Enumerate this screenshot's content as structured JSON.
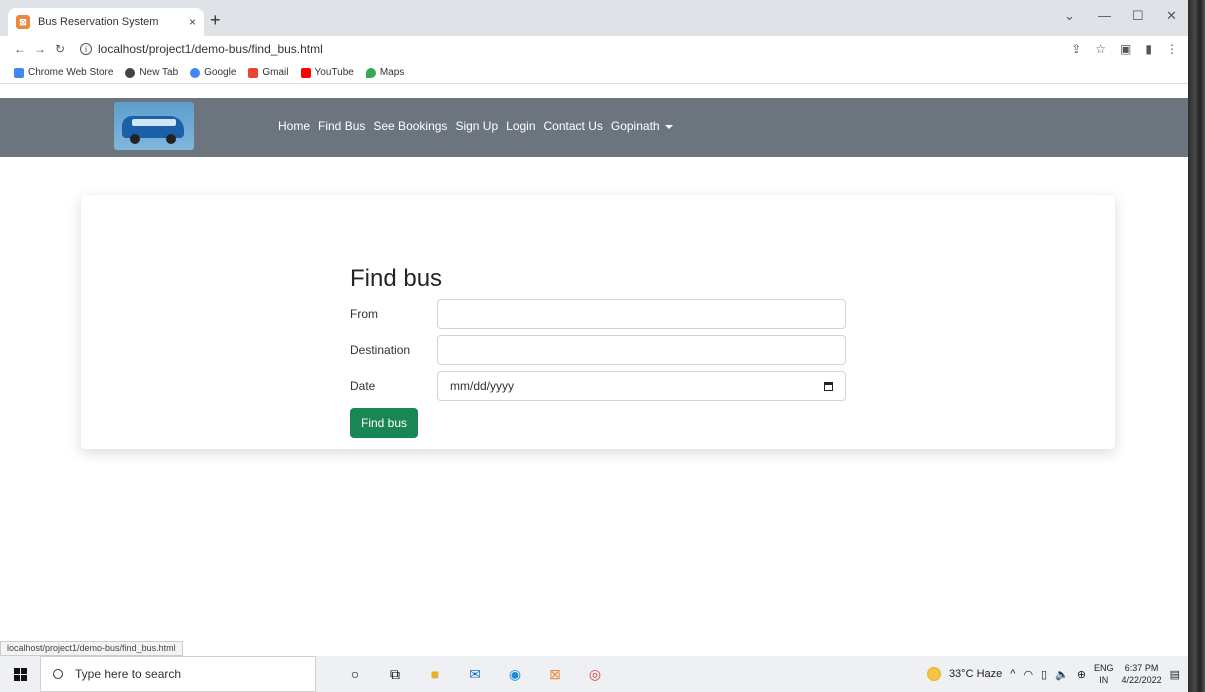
{
  "browser": {
    "tab_title": "Bus Reservation System",
    "tab_close": "×",
    "new_tab": "+",
    "url": "localhost/project1/demo-bus/find_bus.html",
    "bookmarks": [
      {
        "label": "Chrome Web Store",
        "color": "#4285f4"
      },
      {
        "label": "New Tab",
        "color": "#444444"
      },
      {
        "label": "Google",
        "color": "#4285f4"
      },
      {
        "label": "Gmail",
        "color": "#ea4335"
      },
      {
        "label": "YouTube",
        "color": "#ff0000"
      },
      {
        "label": "Maps",
        "color": "#34a853"
      }
    ],
    "status_url": "localhost/project1/demo-bus/find_bus.html"
  },
  "nav": {
    "links": [
      "Home",
      "Find Bus",
      "See Bookings",
      "Sign Up",
      "Login",
      "Contact Us",
      "Gopinath"
    ],
    "bg_color": "#6c757d"
  },
  "form": {
    "title": "Find bus",
    "from_label": "From",
    "destination_label": "Destination",
    "date_label": "Date",
    "date_placeholder": "mm/dd/yyyy",
    "submit_label": "Find bus",
    "button_color": "#198754"
  },
  "taskbar": {
    "search_placeholder": "Type here to search",
    "weather": "33°C Haze",
    "lang_top": "ENG",
    "lang_bottom": "IN",
    "time": "6:37 PM",
    "date": "4/22/2022"
  }
}
